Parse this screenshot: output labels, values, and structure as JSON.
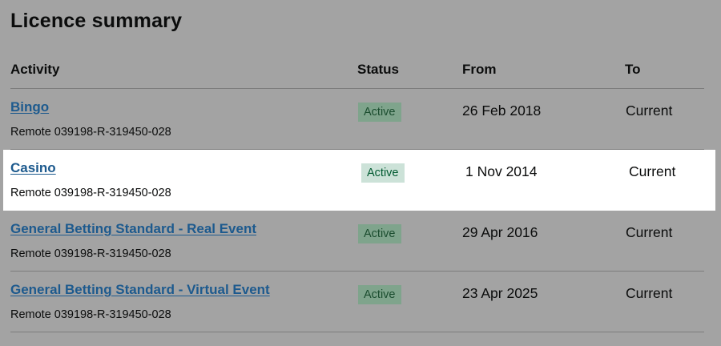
{
  "page": {
    "title": "Licence summary"
  },
  "table": {
    "headers": {
      "activity": "Activity",
      "status": "Status",
      "from": "From",
      "to": "To"
    },
    "rows": [
      {
        "activity": "Bingo",
        "reference": "Remote 039198-R-319450-028",
        "status": "Active",
        "from": "26 Feb 2018",
        "to": "Current"
      },
      {
        "activity": "Casino",
        "reference": "Remote 039198-R-319450-028",
        "status": "Active",
        "from": "1 Nov 2014",
        "to": "Current"
      },
      {
        "activity": "General Betting Standard - Real Event",
        "reference": "Remote 039198-R-319450-028",
        "status": "Active",
        "from": "29 Apr 2016",
        "to": "Current"
      },
      {
        "activity": "General Betting Standard - Virtual Event",
        "reference": "Remote 039198-R-319450-028",
        "status": "Active",
        "from": "23 Apr 2025",
        "to": "Current"
      }
    ]
  },
  "colors": {
    "overlay_background": "#a3a3a3",
    "highlight_background": "#ffffff",
    "link": "#1d5a8e",
    "badge_background": "#cce2d8",
    "badge_text": "#005a30"
  }
}
